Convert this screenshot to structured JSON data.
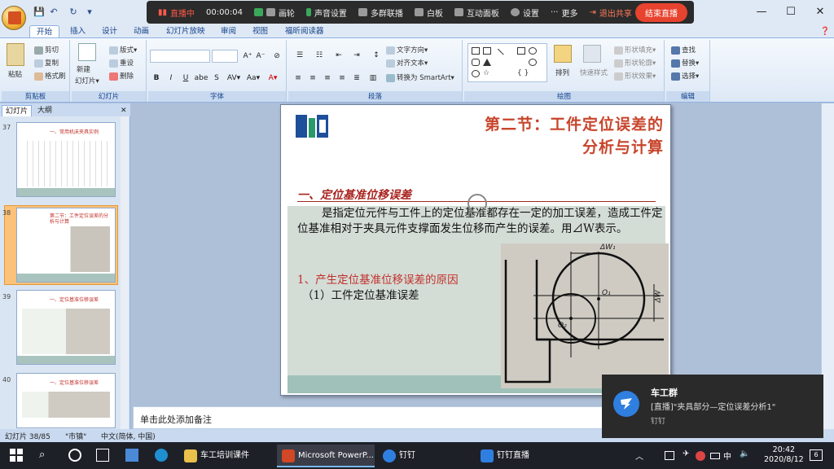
{
  "livebar": {
    "status": "直播中",
    "timer": "00:00:04",
    "items": [
      "画轮",
      "声音设置",
      "多群联播",
      "白板",
      "互动面板",
      "设置",
      "更多"
    ],
    "exit_share": "退出共享",
    "end_live": "结束直播"
  },
  "qat": {
    "sep": "▾"
  },
  "window": {
    "min": "—",
    "max": "☐",
    "close": "✕"
  },
  "tabs": [
    "开始",
    "插入",
    "设计",
    "动画",
    "幻灯片放映",
    "审阅",
    "视图",
    "福昕阅读器"
  ],
  "ribbon": {
    "clipboard": {
      "label": "剪贴板",
      "paste": "粘贴",
      "cut": "剪切",
      "copy": "复制",
      "format_painter": "格式刷"
    },
    "slides": {
      "label": "幻灯片",
      "new_slide": "新建",
      "new_slide2": "幻灯片▾",
      "layout": "版式▾",
      "reset": "重设",
      "delete": "删除"
    },
    "font": {
      "label": "字体",
      "bold": "B",
      "italic": "I",
      "underline": "U",
      "strike": "abe",
      "shadow": "S",
      "spacing": "AV▾",
      "case": "Aa▾",
      "color": "A▾",
      "grow": "A⁺",
      "shrink": "A⁻",
      "clear": "⊘"
    },
    "paragraph": {
      "label": "段落",
      "text_dir": "文字方向▾",
      "align_text": "对齐文本▾",
      "smartart": "转换为 SmartArt▾"
    },
    "drawing": {
      "label": "绘图",
      "arrange": "排列",
      "quick_styles": "快速样式",
      "fill": "形状填充▾",
      "outline": "形状轮廓▾",
      "effects": "形状效果▾"
    },
    "editing": {
      "label": "编辑",
      "find": "查找",
      "replace": "替换▾",
      "select": "选择▾"
    }
  },
  "pane": {
    "tab_slides": "幻灯片",
    "tab_outline": "大纲",
    "close": "✕"
  },
  "thumbs": [
    {
      "num": "37",
      "title": "一、常用机床夹具实例"
    },
    {
      "num": "38",
      "title": "第二节：工件定位误差的分析与计算"
    },
    {
      "num": "39",
      "title": "一、定位基准位移误差"
    },
    {
      "num": "40",
      "title": "一、定位基准位移误差"
    }
  ],
  "slide": {
    "title_line1": "第二节：工件定位误差的",
    "title_line2": "分析与计算",
    "heading": "一、定位基准位移误差",
    "paragraph": "是指定位元件与工件上的定位基准都存在一定的加工误差，造成工件定位基准相对于夹具元件支撑面发生位移而产生的误差。用⊿W表示。",
    "sub1": "1、产生定位基准位移误差的原因",
    "sub2": "（1）工件定位基准误差",
    "diagram_labels": {
      "dw1": "ΔW₁",
      "dw2": "ΔW",
      "o1": "O₁",
      "o2": "O₂"
    }
  },
  "notes": {
    "placeholder": "单击此处添加备注"
  },
  "status": {
    "slide": "幻灯片 38/85",
    "theme": "\"市镇\"",
    "lang": "中文(简体, 中国)"
  },
  "toast": {
    "title": "车工群",
    "message": "[直播]\"夹具部分—定位误差分析1\"",
    "app": "钉钉"
  },
  "taskbar": {
    "apps": [
      "车工培训课件",
      "Microsoft PowerP...",
      "钉钉",
      "钉钉直播"
    ],
    "time": "20:42",
    "date": "2020/8/12",
    "ime": "中",
    "notif_count": "6"
  },
  "colors": {
    "accent": "#15428b",
    "slide_title": "#c8452c",
    "live_end": "#e8432f"
  }
}
